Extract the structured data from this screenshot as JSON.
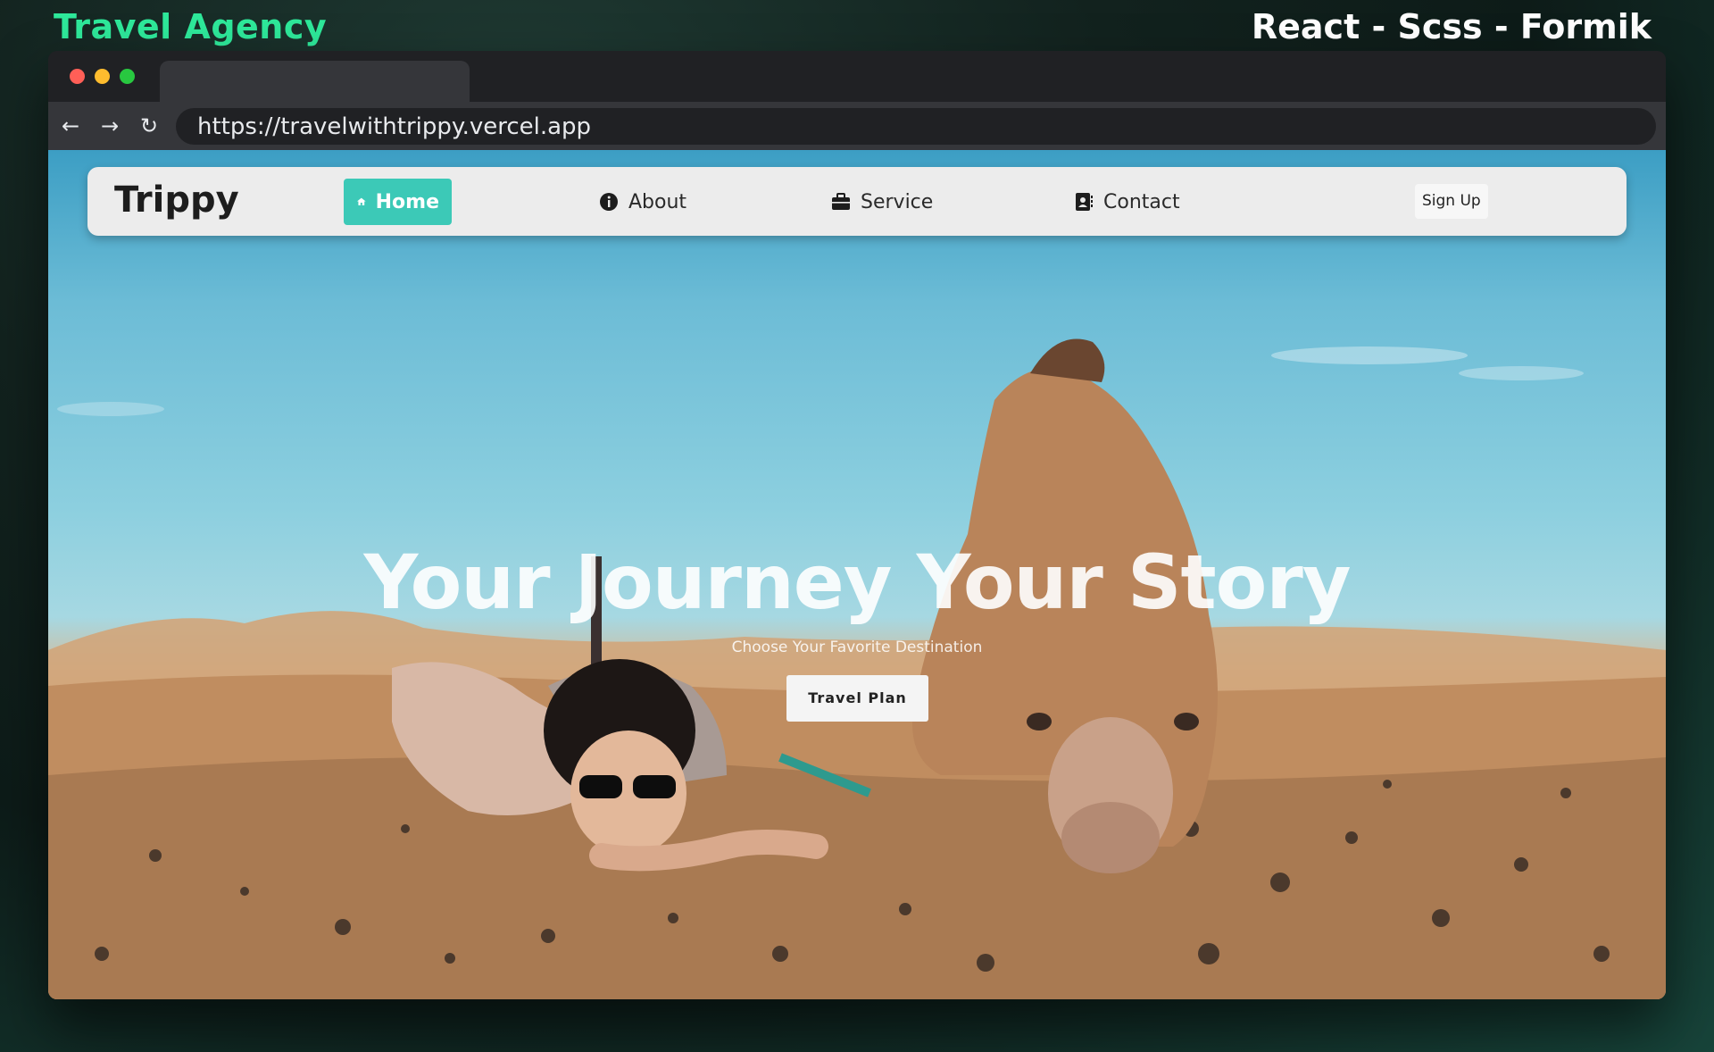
{
  "promo": {
    "left_title": "Travel Agency",
    "right_title": "React - Scss - Formik"
  },
  "browser": {
    "url": "https://travelwithtrippy.vercel.app",
    "nav_icons": [
      "back-arrow-icon",
      "forward-arrow-icon",
      "reload-icon"
    ]
  },
  "site": {
    "brand": "Trippy",
    "nav": [
      {
        "label": "Home",
        "icon": "home-icon",
        "active": true
      },
      {
        "label": "About",
        "icon": "info-icon",
        "active": false
      },
      {
        "label": "Service",
        "icon": "briefcase-icon",
        "active": false
      },
      {
        "label": "Contact",
        "icon": "contact-book-icon",
        "active": false
      }
    ],
    "signup_label": "Sign Up",
    "accent_color": "#3cc9b7"
  },
  "hero": {
    "title": "Your Journey Your Story",
    "subtitle": "Choose Your Favorite Destination",
    "cta_label": "Travel Plan"
  }
}
